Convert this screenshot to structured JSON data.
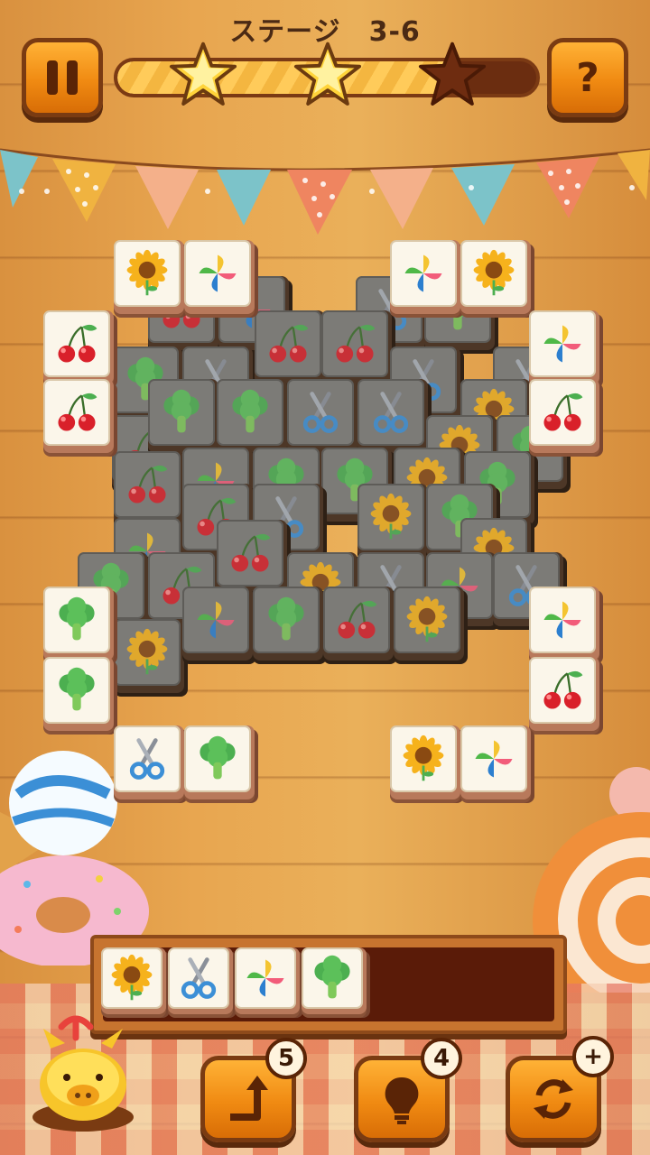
{
  "header": {
    "title": "ステージ　3-6",
    "progress_fraction": 0.82,
    "stars_earned": 2,
    "stars_total": 3
  },
  "buttons": {
    "pause_icon": "pause-icon",
    "help_label": "?",
    "undo_count": "5",
    "hint_count": "4",
    "shuffle_badge": "+"
  },
  "colors": {
    "button_orange": "#f08a12",
    "button_border": "#7a3b12",
    "tile_face": "#fbf6ea",
    "tile_locked": "#7c7b77",
    "tray_bg": "#5a1b08"
  },
  "board": {
    "free_tiles": [
      "sunflower",
      "pinwheel",
      "pinwheel",
      "sunflower",
      "cherry",
      "pinwheel",
      "cherry",
      "cherry",
      "broccoli",
      "pinwheel",
      "broccoli",
      "cherry",
      "scissors",
      "broccoli",
      "sunflower",
      "pinwheel"
    ],
    "locked_tiles": [
      "cherry",
      "pinwheel",
      "scissors",
      "broccoli",
      "broccoli",
      "scissors",
      "cherry",
      "cherry",
      "scissors",
      "scissors",
      "sunflower",
      "cherry",
      "broccoli",
      "broccoli",
      "scissors",
      "scissors",
      "sunflower",
      "broccoli",
      "cherry",
      "pinwheel",
      "broccoli",
      "broccoli",
      "sunflower",
      "broccoli",
      "pinwheel",
      "cherry",
      "scissors",
      "sunflower",
      "broccoli",
      "sunflower",
      "broccoli",
      "cherry",
      "cherry",
      "sunflower",
      "scissors",
      "pinwheel",
      "scissors",
      "sunflower",
      "pinwheel",
      "broccoli",
      "cherry",
      "sunflower"
    ]
  },
  "tray": {
    "slots": [
      "sunflower",
      "scissors",
      "pinwheel",
      "broccoli"
    ],
    "capacity": 7
  }
}
